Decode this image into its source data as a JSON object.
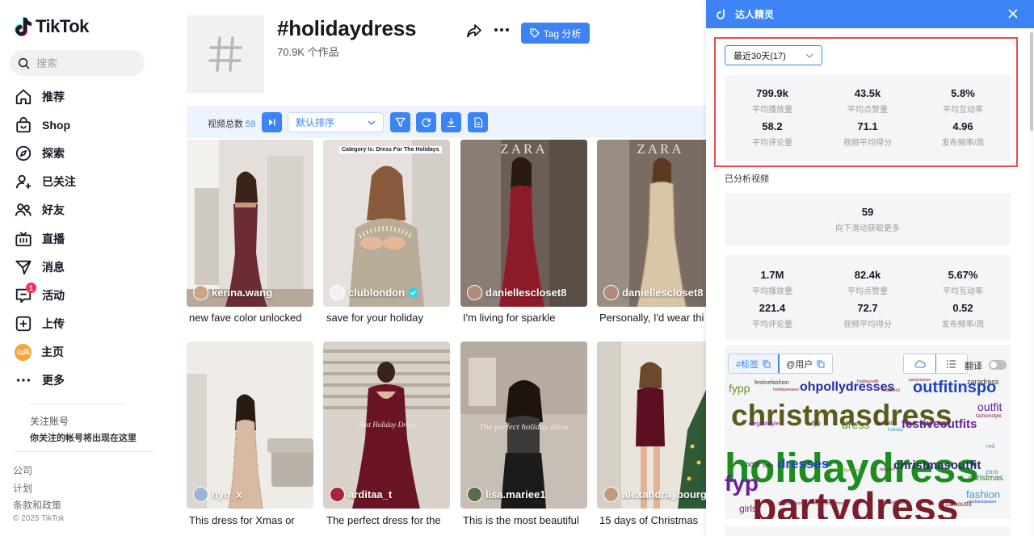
{
  "brand": {
    "name": "TikTok"
  },
  "search": {
    "placeholder": "搜索"
  },
  "nav": [
    {
      "label": "推荐",
      "icon": "home-icon"
    },
    {
      "label": "Shop",
      "icon": "shopping-bag-icon"
    },
    {
      "label": "探索",
      "icon": "compass-icon"
    },
    {
      "label": "已关注",
      "icon": "user-follow-icon"
    },
    {
      "label": "好友",
      "icon": "friends-icon"
    },
    {
      "label": "直播",
      "icon": "live-tv-icon"
    },
    {
      "label": "消息",
      "icon": "message-send-icon"
    },
    {
      "label": "活动",
      "icon": "activity-icon",
      "badge": "1"
    },
    {
      "label": "上传",
      "icon": "upload-plus-icon"
    },
    {
      "label": "主页",
      "icon": "profile-avatar",
      "avatar_text": "山风"
    },
    {
      "label": "更多",
      "icon": "more-dots-icon"
    }
  ],
  "follow": {
    "title": "关注账号",
    "desc": "你关注的帐号将出现在这里"
  },
  "footer": {
    "links": [
      "公司",
      "计划",
      "条款和政策"
    ],
    "copyright": "© 2025 TikTok"
  },
  "tag": {
    "title": "#holidaydress",
    "count": "70.9K 个作品",
    "analysis_button": "Tag 分析"
  },
  "toolbar": {
    "label": "视频总数",
    "count": "59",
    "sort": "默认排序"
  },
  "videos": [
    {
      "author": "kerina.wang",
      "caption": "new fave color unlocked"
    },
    {
      "author": "clublondon",
      "caption": "save for your holiday",
      "overlay": "Category Is: Dress For The Holidays",
      "verified": true
    },
    {
      "author": "daniellescloset8",
      "caption": "I'm living for sparkle",
      "overlay": "ZARA"
    },
    {
      "author": "daniellescloset8",
      "caption": "Personally, I'd wear thi",
      "overlay": "ZARA"
    },
    {
      "author": "hyn_x",
      "caption": "This dress for Xmas or"
    },
    {
      "author": "arditaa_t",
      "caption": "The perfect dress for the",
      "overlay": "Best Holiday Dress"
    },
    {
      "author": "lisa.mariee1",
      "caption": "This is the most beautiful",
      "overlay": "The perfect holiday dress"
    },
    {
      "author": "alexandra_bourg...",
      "caption": "15 days of Christmas"
    }
  ],
  "panel": {
    "title": "达人精灵",
    "period": "最近30天(17)",
    "stats_recent": [
      {
        "value": "799.9k",
        "label": "平均播放量"
      },
      {
        "value": "43.5k",
        "label": "平均点赞量"
      },
      {
        "value": "5.8%",
        "label": "平均互动率"
      },
      {
        "value": "58.2",
        "label": "平均评论量"
      },
      {
        "value": "71.1",
        "label": "视频平均得分"
      },
      {
        "value": "4.96",
        "label": "发布频率/周"
      }
    ],
    "analyzed_label": "已分析视频",
    "analyzed_count": "59",
    "analyzed_hint": "向下滑动获取更多",
    "stats_all": [
      {
        "value": "1.7M",
        "label": "平均播放量"
      },
      {
        "value": "82.4k",
        "label": "平均点赞量"
      },
      {
        "value": "5.67%",
        "label": "平均互动率"
      },
      {
        "value": "221.4",
        "label": "平均评论量"
      },
      {
        "value": "72.7",
        "label": "视频平均得分"
      },
      {
        "value": "0.52",
        "label": "发布频率/周"
      }
    ],
    "tab_tags": "#标签",
    "tab_users": "@用户",
    "translate_label": "翻译"
  },
  "wordcloud": [
    {
      "text": "partydress",
      "color": "#7a1e2b"
    },
    {
      "text": "holidaydress",
      "color": "#1e8c1e"
    },
    {
      "text": "christmasdress",
      "color": "#5c5a1a"
    },
    {
      "text": "fyp",
      "color": "#6a1f9e"
    },
    {
      "text": "outfitinspo",
      "color": "#1e44c8"
    },
    {
      "text": "ohpollydresses",
      "color": "#2a2aa8"
    },
    {
      "text": "festiveoutfits",
      "color": "#6a1f9e"
    },
    {
      "text": "christmasoutfit",
      "color": "#2a2a6e"
    },
    {
      "text": "dresses",
      "color": "#1e44c8"
    },
    {
      "text": "dress",
      "color": "#6b8e23"
    },
    {
      "text": "fypp",
      "color": "#6b8e23"
    },
    {
      "text": "outfit",
      "color": "#6a1f9e"
    },
    {
      "text": "fashion",
      "color": "#3a9ec8"
    },
    {
      "text": "girls",
      "color": "#7a1e6b"
    },
    {
      "text": "christmas",
      "color": "#2a6e2a"
    },
    {
      "text": "zaradress",
      "color": "#333333"
    },
    {
      "text": "festivefashion",
      "color": "#3a3a3a"
    },
    {
      "text": "elegantstyle",
      "color": "#6a1f9e"
    },
    {
      "text": "zara",
      "color": "#3a9ec8"
    },
    {
      "text": "ootd",
      "color": "#333333"
    },
    {
      "text": "zaraoutfit",
      "color": "#7a1e2b"
    },
    {
      "text": "holiday",
      "color": "#3a9ec8"
    },
    {
      "text": "reddress",
      "color": "#7a1e2b"
    },
    {
      "text": "zarafinds",
      "color": "#333333"
    },
    {
      "text": "partyseason",
      "color": "#7a1e2b"
    },
    {
      "text": "fashionstyle",
      "color": "#7a1e2b"
    },
    {
      "text": "fashionispower",
      "color": "#1e44c8"
    },
    {
      "text": "sparklydress",
      "color": "#6b8e23"
    },
    {
      "text": "babydoll",
      "color": "#7a1e2b"
    },
    {
      "text": "holidaydresses",
      "color": "#7a1e2b"
    },
    {
      "text": "holidayoutfit",
      "color": "#7a1e2b"
    },
    {
      "text": "embellisheddress",
      "color": "#7a1e2b"
    },
    {
      "text": "christmasparty",
      "color": "#7a1e6b"
    },
    {
      "text": "ootn",
      "color": "#333333"
    },
    {
      "text": "red",
      "color": "#3a9ec8"
    },
    {
      "text": "fyp",
      "color": "#333333"
    },
    {
      "text": "holidayseason",
      "color": "#7a1e2b"
    }
  ]
}
